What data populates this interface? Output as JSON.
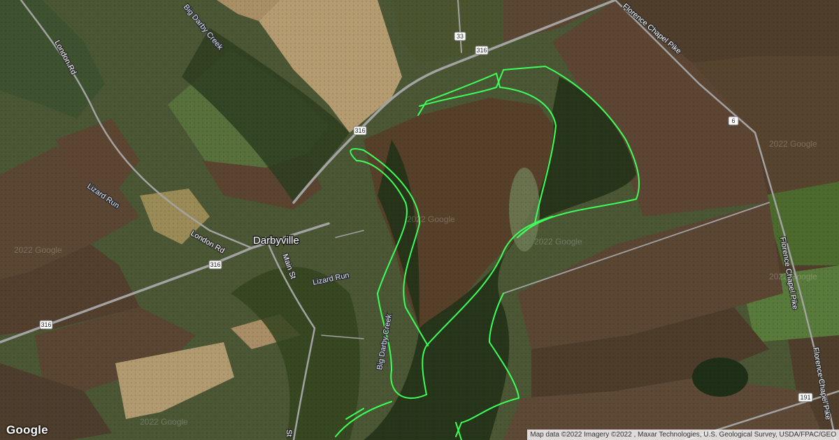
{
  "map": {
    "place": "Darbyville",
    "roads": {
      "london_rd_a": "London Rd",
      "london_rd_b": "London Rd",
      "main_st": "Main St",
      "st_bottom": "St",
      "florence_a": "Florence Chapel Pike",
      "florence_b": "Florence Chapel Pike",
      "florence_c": "Florence Chapel Pike"
    },
    "waterways": {
      "big_darby_top": "Big Darby Creek",
      "big_darby_bottom": "Big Darby Creek",
      "lizard_run_a": "Lizard Run",
      "lizard_run_b": "Lizard Run"
    },
    "route_shields": [
      "316",
      "316",
      "316",
      "316",
      "33",
      "6",
      "191"
    ],
    "watermark": "2022 Google",
    "logo": "Google",
    "attribution": "Map data ©2022 Imagery ©2022 , Maxar Technologies, U.S. Geological Survey, USDA/FPAC/GEO",
    "colors": {
      "trail": "#3dff5a",
      "road": "#9a9a9a",
      "field_brown": "#5a4530",
      "field_tan": "#b49a6c",
      "forest": "#24341a",
      "grass": "#4f6b34"
    }
  }
}
